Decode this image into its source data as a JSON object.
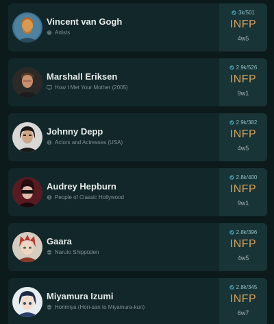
{
  "profiles": [
    {
      "name": "Vincent van Gogh",
      "category": "Artists",
      "category_icon": "palette-icon",
      "votes": "3k/501",
      "mbti": "INFP",
      "enneagram": "4w5"
    },
    {
      "name": "Marshall Eriksen",
      "category": "How I Met Your Mother (2005)",
      "category_icon": "tv-icon",
      "votes": "2.9k/526",
      "mbti": "INFP",
      "enneagram": "9w1"
    },
    {
      "name": "Johnny Depp",
      "category": "Actors and Actresses (USA)",
      "category_icon": "person-icon",
      "votes": "2.9k/382",
      "mbti": "INFP",
      "enneagram": "4w5"
    },
    {
      "name": "Audrey Hepburn",
      "category": "People of Classic Hollywood",
      "category_icon": "person-icon",
      "votes": "2.8k/400",
      "mbti": "INFP",
      "enneagram": "9w1"
    },
    {
      "name": "Gaara",
      "category": "Naruto Shippūden",
      "category_icon": "anime-icon",
      "votes": "2.8k/396",
      "mbti": "INFP",
      "enneagram": "4w5"
    },
    {
      "name": "Miyamura Izumi",
      "category": "Horimiya (Hori-san to Miyamura-kun)",
      "category_icon": "anime-icon",
      "votes": "2.8k/345",
      "mbti": "INFP",
      "enneagram": "6w7"
    }
  ],
  "colors": {
    "background": "#0c1a1c",
    "card": "#122729",
    "type_panel": "#183436",
    "type_text": "#d3a15a",
    "votes_text": "#8fbfc7"
  }
}
